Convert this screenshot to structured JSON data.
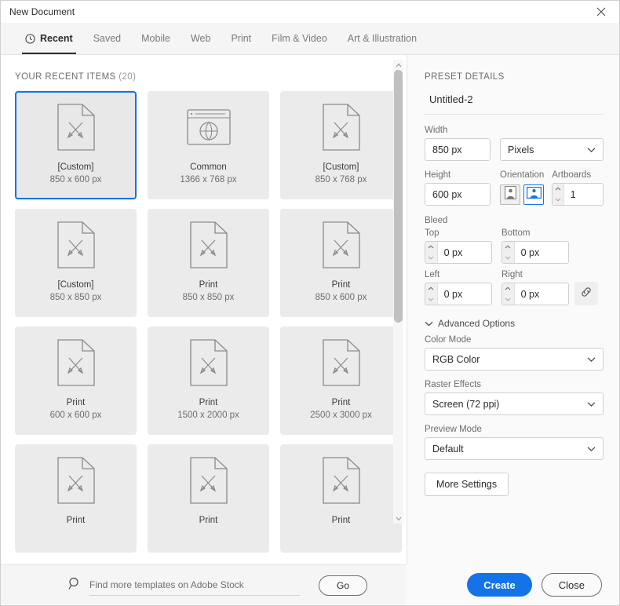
{
  "window": {
    "title": "New Document",
    "close_icon": "close-icon"
  },
  "tabs": [
    {
      "label": "Recent",
      "icon": "clock-icon",
      "active": true
    },
    {
      "label": "Saved",
      "icon": "",
      "active": false
    },
    {
      "label": "Mobile",
      "icon": "",
      "active": false
    },
    {
      "label": "Web",
      "icon": "",
      "active": false
    },
    {
      "label": "Print",
      "icon": "",
      "active": false
    },
    {
      "label": "Film & Video",
      "icon": "",
      "active": false
    },
    {
      "label": "Art & Illustration",
      "icon": "",
      "active": false
    }
  ],
  "recent": {
    "heading": "YOUR RECENT ITEMS",
    "count": "(20)",
    "items": [
      {
        "label": "[Custom]",
        "dims": "850 x 600 px",
        "icon": "document-pencil-ruler-icon",
        "selected": true
      },
      {
        "label": "Common",
        "dims": "1366 x 768 px",
        "icon": "browser-globe-icon",
        "selected": false
      },
      {
        "label": "[Custom]",
        "dims": "850 x 768 px",
        "icon": "document-pencil-ruler-icon",
        "selected": false
      },
      {
        "label": "[Custom]",
        "dims": "850 x 850 px",
        "icon": "document-pencil-ruler-icon",
        "selected": false
      },
      {
        "label": "Print",
        "dims": "850 x 850 px",
        "icon": "document-pencil-ruler-icon",
        "selected": false
      },
      {
        "label": "Print",
        "dims": "850 x 600 px",
        "icon": "document-pencil-ruler-icon",
        "selected": false
      },
      {
        "label": "Print",
        "dims": "600 x 600 px",
        "icon": "document-pencil-ruler-icon",
        "selected": false
      },
      {
        "label": "Print",
        "dims": "1500 x 2000 px",
        "icon": "document-pencil-ruler-icon",
        "selected": false
      },
      {
        "label": "Print",
        "dims": "2500 x 3000 px",
        "icon": "document-pencil-ruler-icon",
        "selected": false
      },
      {
        "label": "Print",
        "dims": "",
        "icon": "document-pencil-ruler-icon",
        "selected": false
      },
      {
        "label": "Print",
        "dims": "",
        "icon": "document-pencil-ruler-icon",
        "selected": false
      },
      {
        "label": "Print",
        "dims": "",
        "icon": "document-pencil-ruler-icon",
        "selected": false
      }
    ]
  },
  "stock": {
    "search_icon": "search-icon",
    "placeholder": "Find more templates on Adobe Stock",
    "value": "",
    "go_label": "Go"
  },
  "preset": {
    "heading": "PRESET DETAILS",
    "doc_name": "Untitled-2",
    "width_label": "Width",
    "width_value": "850 px",
    "units_value": "Pixels",
    "height_label": "Height",
    "height_value": "600 px",
    "orientation_label": "Orientation",
    "orientation_portrait_icon": "portrait-orientation-icon",
    "orientation_landscape_icon": "landscape-orientation-icon",
    "orientation_selected": "landscape",
    "artboards_label": "Artboards",
    "artboards_value": "1",
    "bleed_label": "Bleed",
    "bleed_top_label": "Top",
    "bleed_top_value": "0 px",
    "bleed_bottom_label": "Bottom",
    "bleed_bottom_value": "0 px",
    "bleed_left_label": "Left",
    "bleed_left_value": "0 px",
    "bleed_right_label": "Right",
    "bleed_right_value": "0 px",
    "bleed_link_icon": "link-chain-icon",
    "advanced_label": "Advanced Options",
    "advanced_chevron_icon": "chevron-down-icon",
    "color_mode_label": "Color Mode",
    "color_mode_value": "RGB Color",
    "raster_effects_label": "Raster Effects",
    "raster_effects_value": "Screen (72 ppi)",
    "preview_mode_label": "Preview Mode",
    "preview_mode_value": "Default",
    "more_settings_label": "More Settings"
  },
  "footer": {
    "create_label": "Create",
    "close_label": "Close"
  },
  "colors": {
    "accent": "#1473e6",
    "card_bg": "#ebebeb",
    "panel_bg": "#fafafa",
    "text": "#2c2c2c",
    "muted": "#6d6d6d"
  }
}
